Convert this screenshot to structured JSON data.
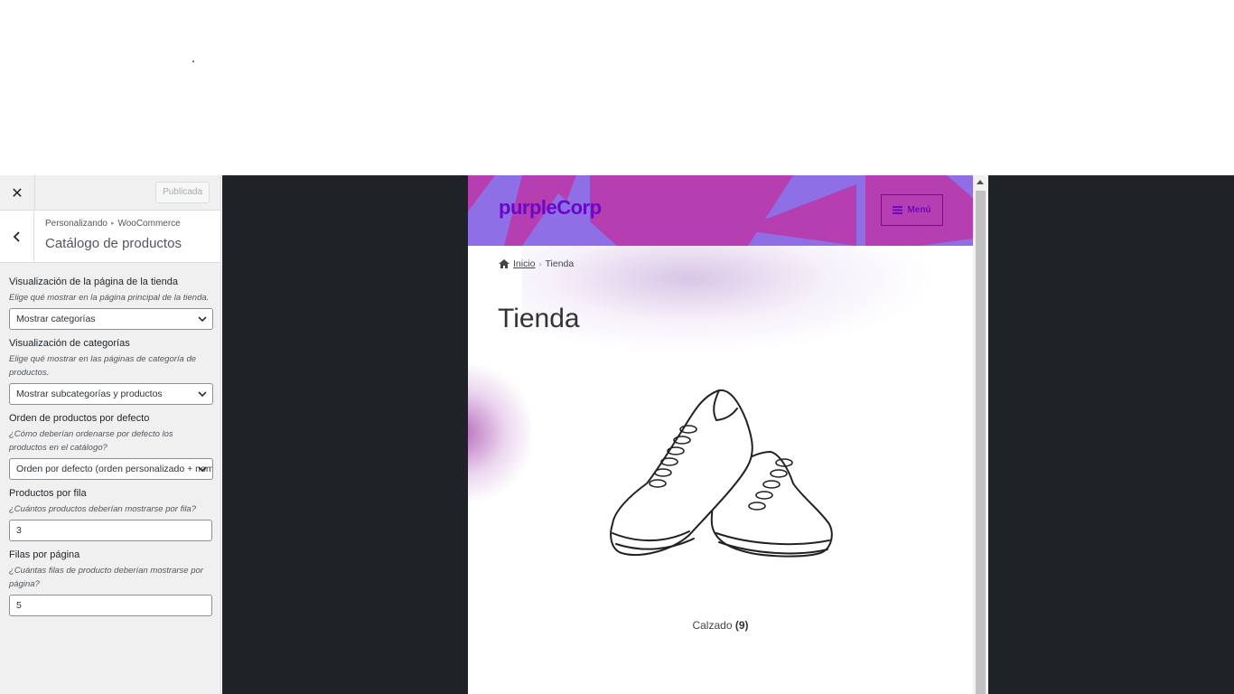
{
  "customizer": {
    "close_label": "✕",
    "publish_label": "Publicada",
    "breadcrumb_root": "Personalizando",
    "breadcrumb_current": "WooCommerce",
    "section_title": "Catálogo de productos",
    "controls": [
      {
        "label": "Visualización de la página de la tienda",
        "description": "Elige qué mostrar en la página principal de la tienda.",
        "value": "Mostrar categorías"
      },
      {
        "label": "Visualización de categorías",
        "description": "Elige qué mostrar en las páginas de categoría de productos.",
        "value": "Mostrar subcategorías y productos"
      },
      {
        "label": "Orden de productos por defecto",
        "description": "¿Cómo deberían ordenarse por defecto los productos en el catálogo?",
        "value": "Orden por defecto (orden personalizado + nombre)"
      },
      {
        "label": "Productos por fila",
        "description": "¿Cuántos productos deberían mostrarse por fila?",
        "value": "3"
      },
      {
        "label": "Filas por página",
        "description": "¿Cuántas filas de producto deberían mostrarse por página?",
        "value": "5"
      }
    ]
  },
  "preview": {
    "site_title": "purpleCorp",
    "menu_label": "Menú",
    "breadcrumb_home": "Inicio",
    "breadcrumb_current": "Tienda",
    "page_title": "Tienda",
    "category_name": "Calzado",
    "category_count": "(9)"
  },
  "colors": {
    "brand": "#6b07c9",
    "header_bg": "#8e6fe6",
    "header_pattern": "#b53fb0",
    "preview_frame": "#1f2327"
  }
}
